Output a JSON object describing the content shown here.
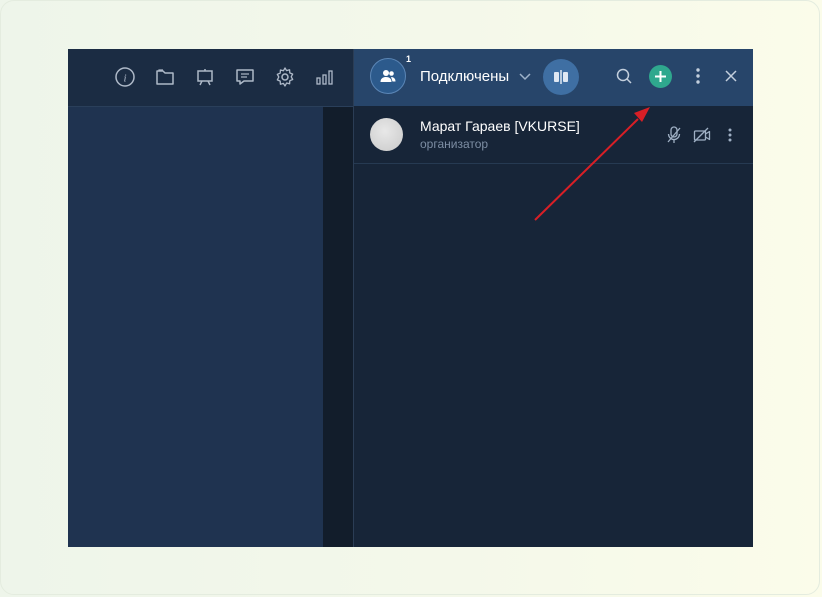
{
  "colors": {
    "accent_add": "#2fa88e",
    "annotation_arrow": "#d81f26",
    "header_bg": "#27456a",
    "panel_bg": "#172538"
  },
  "toolbar": {
    "icons": [
      "info-icon",
      "folder-icon",
      "presentation-board-icon",
      "chat-list-icon",
      "settings-gear-icon",
      "signal-bars-icon"
    ]
  },
  "participants_header": {
    "count_badge": "1",
    "title": "Подключены",
    "icons": [
      "people-icon",
      "chevron-down-icon",
      "layout-split-icon",
      "search-icon",
      "plus-icon",
      "more-vertical-icon",
      "close-icon"
    ]
  },
  "participants": [
    {
      "name": "Марат Гараев [VKURSE]",
      "role": "организатор",
      "icons": [
        "microphone-muted-icon",
        "camera-off-icon",
        "more-vertical-icon"
      ]
    }
  ]
}
